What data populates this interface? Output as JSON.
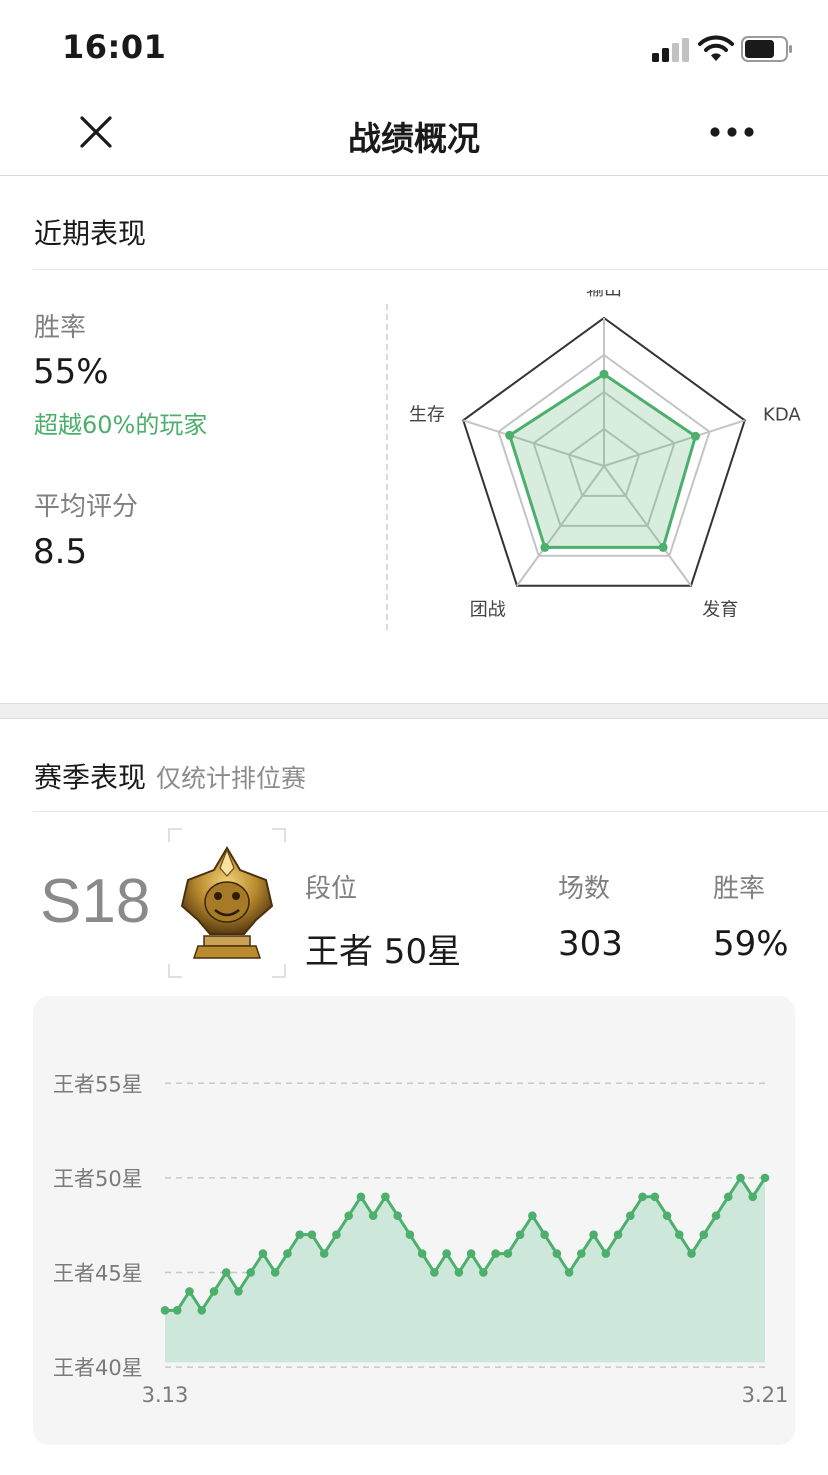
{
  "status_bar": {
    "time": "16:01"
  },
  "nav": {
    "title": "战绩概况",
    "close_icon": "close-icon",
    "more_icon": "more-dots-icon"
  },
  "recent": {
    "title": "近期表现",
    "win_rate_label": "胜率",
    "win_rate_value": "55%",
    "win_rate_note": "超越60%的玩家",
    "avg_score_label": "平均评分",
    "avg_score_value": "8.5",
    "radar": {
      "axes": [
        "输出",
        "KDA",
        "发育",
        "团战",
        "生存"
      ],
      "values": [
        0.62,
        0.65,
        0.68,
        0.68,
        0.67
      ],
      "color": "#4caf6b"
    }
  },
  "season": {
    "title": "赛季表现",
    "subtitle": "仅统计排位赛",
    "code": "S18",
    "rank_label": "段位",
    "rank_value": "王者 50星",
    "games_label": "场数",
    "games_value": "303",
    "winrate_label": "胜率",
    "winrate_value": "59%",
    "badge_icon": "king-rank-badge-icon"
  },
  "chart_data": {
    "type": "area",
    "y_tick_labels": [
      "王者55星",
      "王者50星",
      "王者45星",
      "王者40星"
    ],
    "y_ticks": [
      55,
      50,
      45,
      40
    ],
    "ylim": [
      39,
      57.5
    ],
    "x_start_label": "3.13",
    "x_end_label": "3.21",
    "color": "#4caf6b",
    "fill": "#cde8da",
    "values": [
      43,
      43,
      44,
      43,
      44,
      45,
      44,
      45,
      46,
      45,
      46,
      47,
      47,
      46,
      47,
      48,
      49,
      48,
      49,
      48,
      47,
      46,
      45,
      46,
      45,
      46,
      45,
      46,
      46,
      47,
      48,
      47,
      46,
      45,
      46,
      47,
      46,
      47,
      48,
      49,
      49,
      48,
      47,
      46,
      47,
      48,
      49,
      50,
      49,
      50
    ]
  }
}
